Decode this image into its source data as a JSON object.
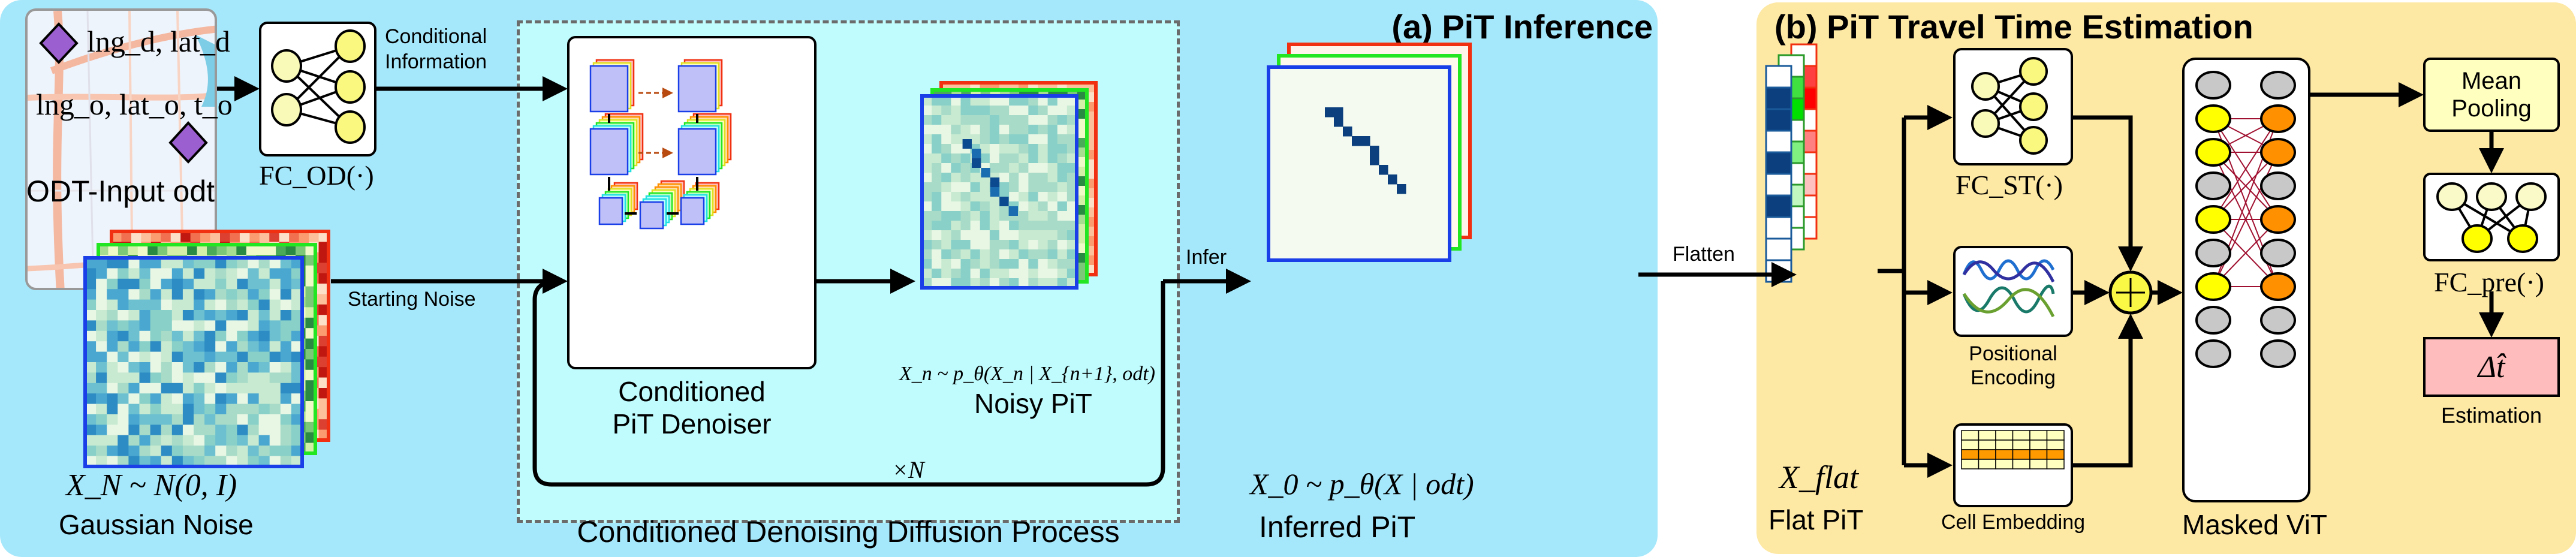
{
  "panel_a": {
    "title": "(a) PiT Inference",
    "odt_input": {
      "dest_label": "lng_d, lat_d",
      "orig_label": "lng_o, lat_o, t_o",
      "caption": "ODT-Input odt"
    },
    "fc_od_label": "FC_OD(·)",
    "conditional_information_label": [
      "Conditional",
      "Information"
    ],
    "starting_noise_label": "Starting Noise",
    "gaussian_noise": {
      "formula": "X_N ~ N(0, I)",
      "caption": "Gaussian Noise"
    },
    "denoiser_caption": [
      "Conditioned",
      "PiT Denoiser"
    ],
    "noisy_pit": {
      "formula": "X_n ~ p_θ(X_n | X_{n+1}, odt)",
      "caption": "Noisy PiT"
    },
    "loop_label": "×N",
    "process_caption": "Conditioned Denoising Diffusion Process",
    "infer_label": "Infer",
    "inferred_pit": {
      "formula": "X_0 ~ p_θ(X | odt)",
      "caption": "Inferred PiT"
    }
  },
  "flatten_label": "Flatten",
  "panel_b": {
    "title": "(b) PiT Travel Time Estimation",
    "flat_pit": {
      "formula": "X_flat",
      "caption": "Flat PiT"
    },
    "fc_st_label": "FC_ST(·)",
    "positional_encoding_label": [
      "Positional",
      "Encoding"
    ],
    "cell_embedding_label": "Cell Embedding",
    "add_symbol": "+",
    "masked_vit_label": "Masked ViT",
    "mean_pooling_label": [
      "Mean",
      "Pooling"
    ],
    "fc_pre_label": "FC_pre(·)",
    "estimation_symbol": "Δt̂",
    "estimation_label": "Estimation"
  },
  "colors": {
    "panel_a_bg": "#a6e8fb",
    "panel_b_bg": "#fde8a4",
    "diffusion_bg": "#c0fbfd",
    "channel_blue": "#1a3ee8",
    "channel_green": "#22e622",
    "channel_red": "#f03010",
    "pit_dark": "#0b3f7d",
    "denoiser_block": "#c0c0f8",
    "node_yellow": "#ffff00",
    "node_orange": "#ff9000",
    "node_gray": "#c8c8c8",
    "estimation_bg": "#ffbcbc",
    "mean_pool_bg": "#ffffc0"
  }
}
